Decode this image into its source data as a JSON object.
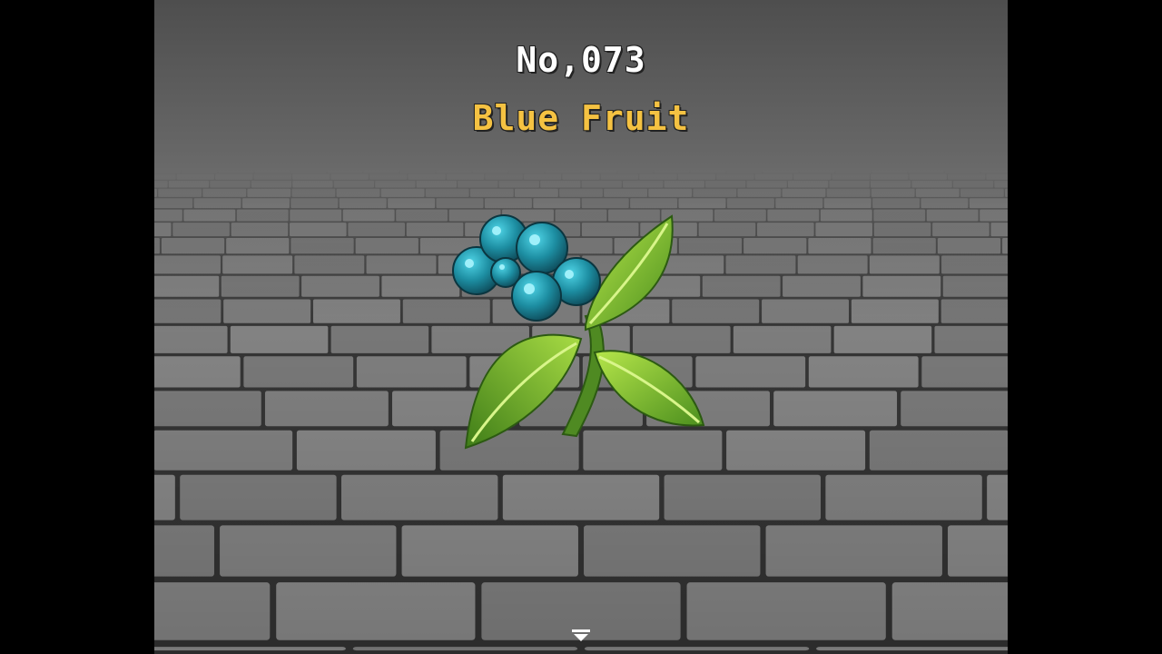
{
  "entry": {
    "number": "No,073",
    "name": "Blue Fruit"
  },
  "icons": {
    "item": "blue-fruit-icon",
    "continue": "down-arrow-icon"
  },
  "colors": {
    "entry_number": "#ffffff",
    "item_name": "#f5c242",
    "berry": "#1f8fa3",
    "leaf": "#7fc23a",
    "floor": "#6e6e6e",
    "sky": "#555555"
  }
}
